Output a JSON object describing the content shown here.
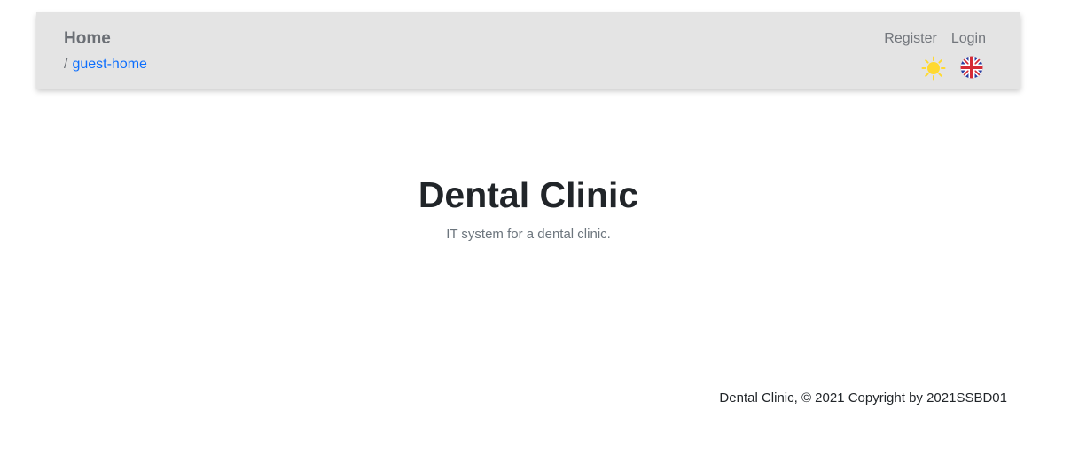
{
  "navbar": {
    "title": "Home",
    "breadcrumb": {
      "separator": "/",
      "current": "guest-home"
    },
    "links": {
      "register": "Register",
      "login": "Login"
    },
    "icons": {
      "theme": "sun-icon",
      "language": "uk-flag-icon"
    },
    "colors": {
      "background": "#e4e4e4",
      "link": "#0d6efd",
      "sun": "#ffd930"
    }
  },
  "hero": {
    "title": "Dental Clinic",
    "subtitle": "IT system for a dental clinic."
  },
  "footer": {
    "text": "Dental Clinic, © 2021 Copyright by 2021SSBD01"
  }
}
